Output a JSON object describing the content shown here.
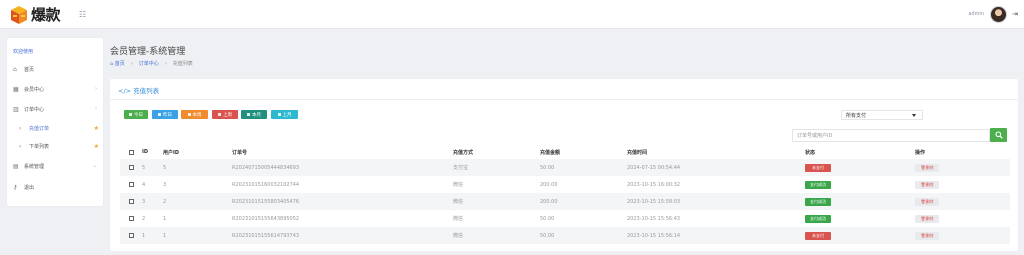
{
  "header": {
    "logo_text": "爆款",
    "admin_name": "admin"
  },
  "sidebar": {
    "welcome": "欢迎使用",
    "items": [
      {
        "label": "首页",
        "icon": "home-icon",
        "expanded": false
      },
      {
        "label": "会员中心",
        "icon": "member-icon",
        "expanded": false
      },
      {
        "label": "订单中心",
        "icon": "chart-icon",
        "expanded": true
      },
      {
        "label": "充值订单",
        "icon": "chevron-right-icon",
        "sub": true,
        "starred": true
      },
      {
        "label": "下单列表",
        "icon": "chevron-right-icon",
        "sub": true,
        "starred": true
      },
      {
        "label": "系统管理",
        "icon": "grid-icon",
        "expanded": true
      },
      {
        "label": "退出",
        "icon": "key-icon"
      }
    ]
  },
  "page": {
    "title": "会员管理-系统管理",
    "breadcrumb": [
      "首页",
      "订单中心",
      "充值列表"
    ]
  },
  "card": {
    "title": "充值列表"
  },
  "filters": {
    "buttons": [
      {
        "label": "今日",
        "color": "#4cae4c"
      },
      {
        "label": "昨日",
        "color": "#3aa1e6"
      },
      {
        "label": "本周",
        "color": "#f08c2e"
      },
      {
        "label": "上周",
        "color": "#d9534f"
      },
      {
        "label": "本月",
        "color": "#1f8f7f"
      },
      {
        "label": "上月",
        "color": "#2cb8d0"
      }
    ],
    "type_select": "所有支付",
    "search_placeholder": "订单号或用户ID"
  },
  "table": {
    "columns": [
      "ID",
      "用户ID",
      "订单号",
      "充值方式",
      "充值金额",
      "充值时间",
      "状态",
      "操作"
    ],
    "rows": [
      {
        "id": "5",
        "user_id": "5",
        "order_no": "R20240715005444834693",
        "method": "支付宝",
        "amount": "50.00",
        "time": "2024-07-15 00:54:44",
        "status": "未支付",
        "status_type": "unpaid",
        "action": "删除"
      },
      {
        "id": "4",
        "user_id": "3",
        "order_no": "R20231015160032102744",
        "method": "微信",
        "amount": "200.00",
        "time": "2023-10-15 16:00:32",
        "status": "支付成功",
        "status_type": "paid",
        "action": "删除"
      },
      {
        "id": "3",
        "user_id": "2",
        "order_no": "R20231015155803405476",
        "method": "微信",
        "amount": "200.00",
        "time": "2023-10-15 15:58:03",
        "status": "支付成功",
        "status_type": "paid",
        "action": "删除"
      },
      {
        "id": "2",
        "user_id": "1",
        "order_no": "R20231015155643895052",
        "method": "微信",
        "amount": "50.00",
        "time": "2023-10-15 15:56:43",
        "status": "支付成功",
        "status_type": "paid",
        "action": "删除"
      },
      {
        "id": "1",
        "user_id": "1",
        "order_no": "R20231015155614793743",
        "method": "微信",
        "amount": "50.00",
        "time": "2023-10-15 15:56:14",
        "status": "未支付",
        "status_type": "unpaid",
        "action": "删除"
      }
    ]
  }
}
